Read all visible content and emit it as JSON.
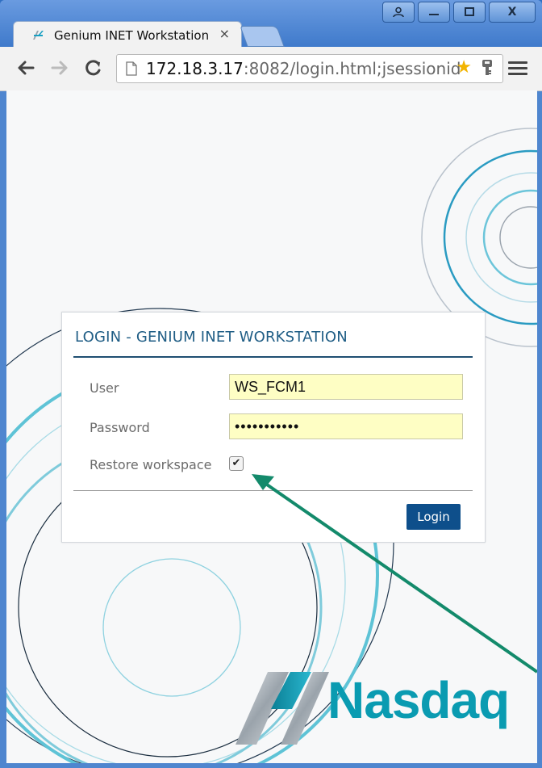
{
  "browser": {
    "tab_title": "Genium INET Workstation",
    "tab_close": "×",
    "url_host": "172.18.3.17",
    "url_rest": ":8082/login.html;jsessionid",
    "back": "←",
    "forward": "→",
    "reload": "C",
    "window_buttons": {
      "user": "",
      "minimize": "",
      "maximize": "",
      "close": "X"
    }
  },
  "login": {
    "title": "LOGIN - GENIUM INET WORKSTATION",
    "user_label": "User",
    "user_value": "WS_FCM1",
    "password_label": "Password",
    "password_value": "•••••••••••",
    "restore_label": "Restore workspace",
    "restore_checked": true,
    "login_button": "Login"
  },
  "branding": {
    "logo_text": "Nasdaq",
    "accent_color": "#0a9bb1",
    "primary_color": "#0e4f8b"
  }
}
